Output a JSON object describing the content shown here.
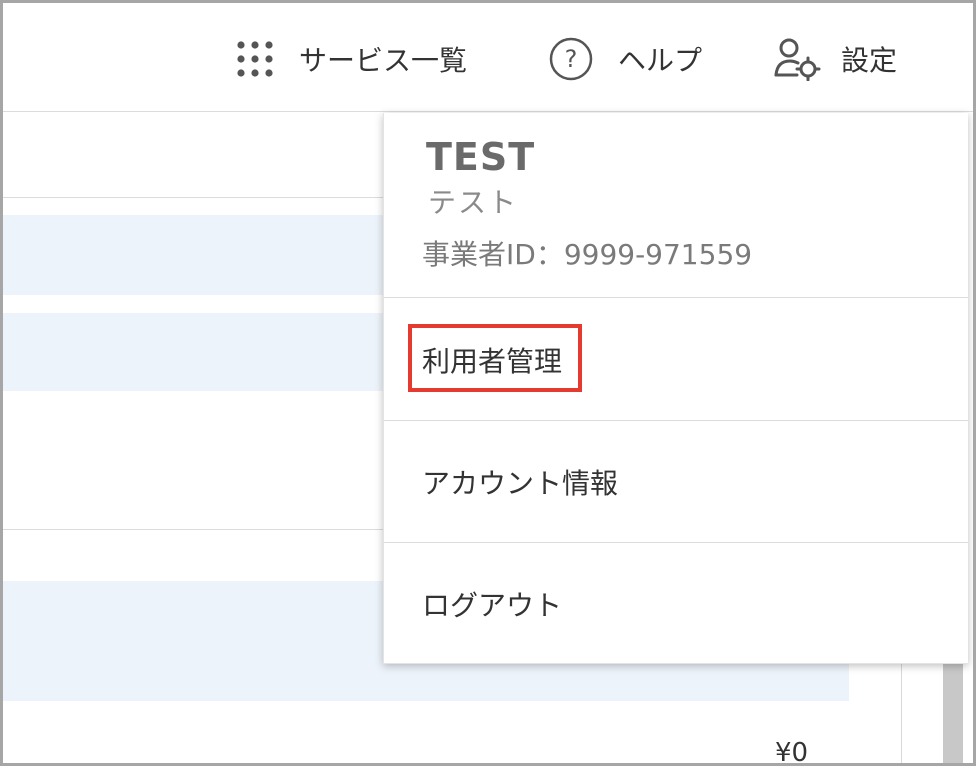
{
  "header": {
    "services_label": "サービス一覧",
    "help_label": "ヘルプ",
    "settings_label": "設定"
  },
  "menu": {
    "account_name": "TEST",
    "account_sub": "テスト",
    "business_id": "事業者ID：9999-971559",
    "items": [
      {
        "label": "利用者管理"
      },
      {
        "label": "アカウント情報"
      },
      {
        "label": "ログアウト"
      }
    ]
  },
  "background": {
    "peek_text": "¥0"
  },
  "colors": {
    "highlight_border": "#e53a2f",
    "row_tint": "#edf3fb"
  }
}
